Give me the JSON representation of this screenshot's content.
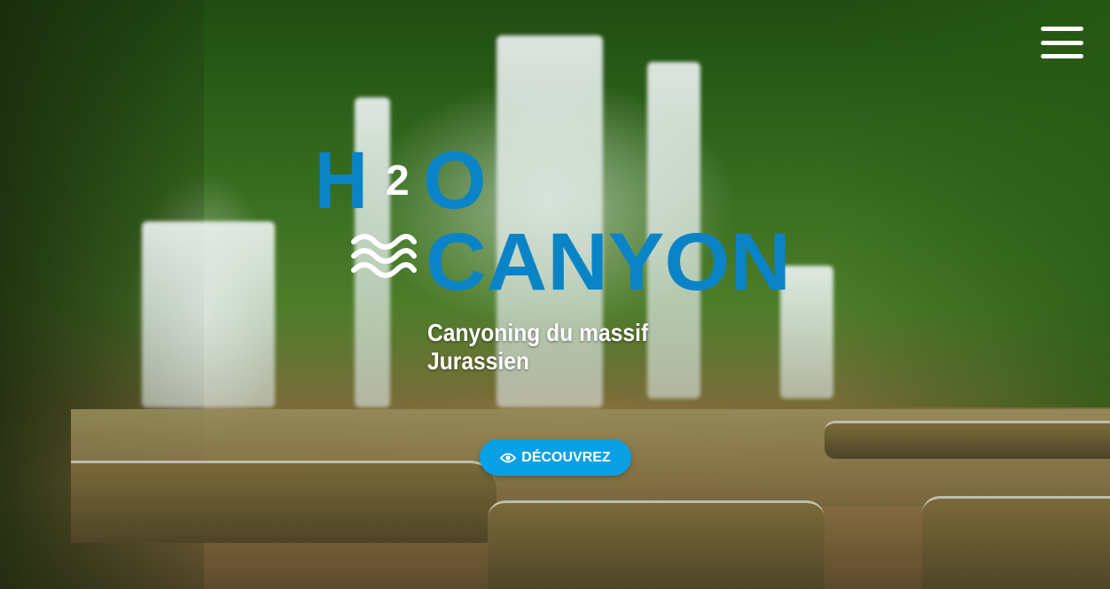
{
  "logo": {
    "h_letter": "H",
    "subscript": "2",
    "o_letter": "O",
    "word": "CANYON",
    "brand_color": "#0a84c6"
  },
  "hero": {
    "tagline": "Canyoning du massif Jurassien",
    "cta_label": "DÉCOUVREZ",
    "cta_icon": "eye-icon",
    "cta_color": "#0aa0e6"
  },
  "nav": {
    "menu_icon": "hamburger-menu-icon"
  }
}
